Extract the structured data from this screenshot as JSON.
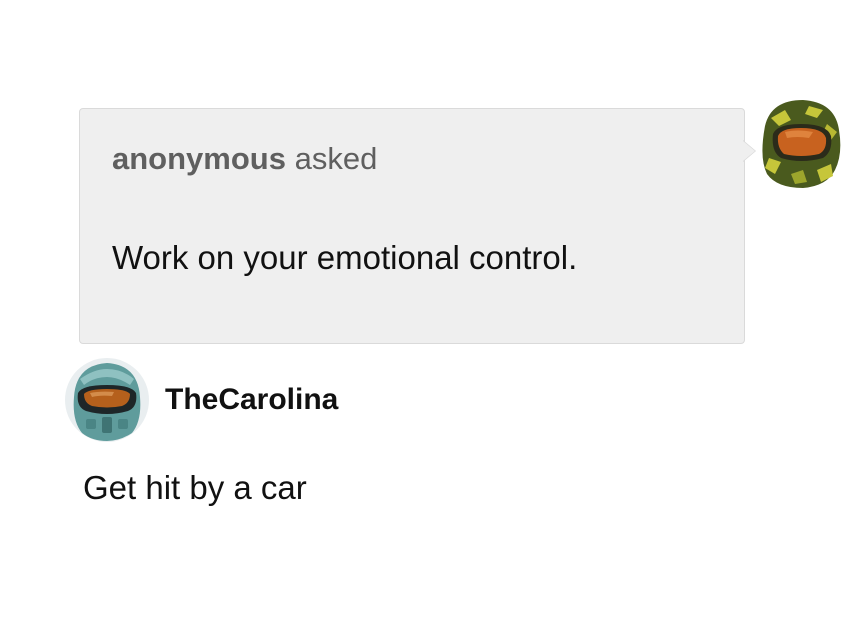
{
  "ask": {
    "sender": "anonymous",
    "verb": "asked",
    "question": "Work on your emotional control."
  },
  "asker_avatar": {
    "icon": "green-spartan-helmet-icon",
    "colors": {
      "shell": "#4a5a1e",
      "camo": "#c6c63a",
      "visor": "#c8621f"
    }
  },
  "answer": {
    "username": "TheCarolina",
    "text": "Get hit by a car"
  },
  "answerer_avatar": {
    "icon": "teal-spartan-helmet-icon",
    "colors": {
      "shell": "#5f9c9c",
      "visor": "#b5601c"
    }
  }
}
